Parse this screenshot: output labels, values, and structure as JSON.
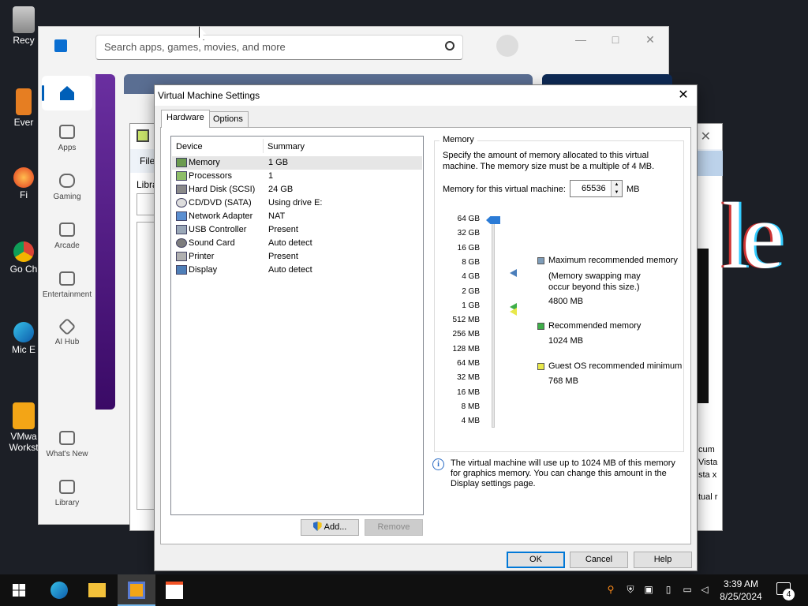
{
  "desktop": {
    "icons": [
      {
        "label": "Recy",
        "icon": "recycle-bin-icon"
      },
      {
        "label": "Ever",
        "icon": "app-icon"
      },
      {
        "label": "Fi",
        "icon": "firefox-icon"
      },
      {
        "label": "Go Ch",
        "icon": "chrome-icon"
      },
      {
        "label": "Mic E",
        "icon": "edge-icon"
      },
      {
        "label": "VMwa Workst",
        "icon": "vmware-icon"
      }
    ]
  },
  "store": {
    "search_placeholder": "Search apps, games, movies, and more",
    "nav": [
      {
        "label": "Apps"
      },
      {
        "label": "Gaming"
      },
      {
        "label": "Arcade"
      },
      {
        "label": "Entertainment"
      },
      {
        "label": "AI Hub"
      },
      {
        "label": "What's New"
      },
      {
        "label": "Library"
      }
    ]
  },
  "vmware_main": {
    "menu_file": "File",
    "library_label": "Libra",
    "right_text": [
      "cum",
      "Vista",
      "sta x",
      "tual r"
    ]
  },
  "dialog": {
    "title": "Virtual Machine Settings",
    "tabs": [
      "Hardware",
      "Options"
    ],
    "device_list": {
      "col_device": "Device",
      "col_summary": "Summary",
      "rows": [
        {
          "name": "Memory",
          "summary": "1 GB",
          "selected": true,
          "icon": "memory-icon"
        },
        {
          "name": "Processors",
          "summary": "1",
          "icon": "processor-icon"
        },
        {
          "name": "Hard Disk (SCSI)",
          "summary": "24 GB",
          "icon": "hard-disk-icon"
        },
        {
          "name": "CD/DVD (SATA)",
          "summary": "Using drive E:",
          "icon": "cd-dvd-icon"
        },
        {
          "name": "Network Adapter",
          "summary": "NAT",
          "icon": "network-adapter-icon"
        },
        {
          "name": "USB Controller",
          "summary": "Present",
          "icon": "usb-icon"
        },
        {
          "name": "Sound Card",
          "summary": "Auto detect",
          "icon": "sound-card-icon"
        },
        {
          "name": "Printer",
          "summary": "Present",
          "icon": "printer-icon"
        },
        {
          "name": "Display",
          "summary": "Auto detect",
          "icon": "display-icon"
        }
      ]
    },
    "add_button": "Add...",
    "remove_button": "Remove",
    "memory": {
      "group_title": "Memory",
      "description": "Specify the amount of memory allocated to this virtual machine. The memory size must be a multiple of 4 MB.",
      "field_label": "Memory for this virtual machine:",
      "value": "65536",
      "unit": "MB",
      "scale": [
        "64 GB",
        "32 GB",
        "16 GB",
        "8 GB",
        "4 GB",
        "2 GB",
        "1 GB",
        "512 MB",
        "256 MB",
        "128 MB",
        "64 MB",
        "32 MB",
        "16 MB",
        "8 MB",
        "4 MB"
      ],
      "legend": {
        "max_title": "Maximum recommended memory",
        "max_note": "(Memory swapping may occur beyond this size.)",
        "max_value": "4800 MB",
        "rec_title": "Recommended memory",
        "rec_value": "1024 MB",
        "min_title": "Guest OS recommended minimum",
        "min_value": "768 MB"
      },
      "info": "The virtual machine will use up to 1024 MB of this memory for graphics memory. You can change this amount in the Display settings page."
    },
    "ok_button": "OK",
    "cancel_button": "Cancel",
    "help_button": "Help"
  },
  "taskbar": {
    "time": "3:39 AM",
    "date": "8/25/2024",
    "notifications": "4"
  },
  "colors": {
    "accent": "#0078d7",
    "max_marker": "#4a7ebb",
    "rec_marker": "#3fae49",
    "min_marker": "#e8e84a"
  }
}
